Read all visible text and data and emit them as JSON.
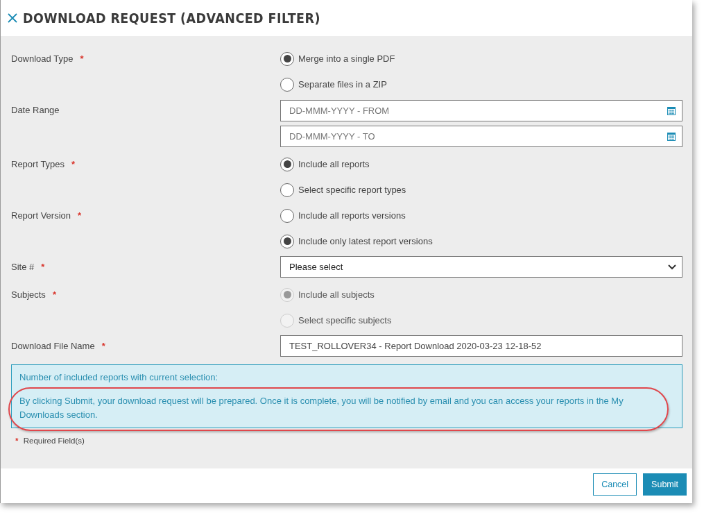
{
  "dialog": {
    "title": "DOWNLOAD REQUEST (ADVANCED FILTER)"
  },
  "required_mark": "*",
  "fields": [
    {
      "label": "Download Type",
      "required": true,
      "kind": "radio",
      "options": [
        {
          "label": "Merge into a single PDF",
          "selected": true,
          "disabled": false
        },
        {
          "label": "Separate files in a ZIP",
          "selected": false,
          "disabled": false
        }
      ]
    },
    {
      "label": "Date Range",
      "required": false,
      "kind": "date",
      "inputs": [
        {
          "placeholder": "DD-MMM-YYYY - FROM"
        },
        {
          "placeholder": "DD-MMM-YYYY - TO"
        }
      ]
    },
    {
      "label": "Report Types",
      "required": true,
      "kind": "radio",
      "options": [
        {
          "label": "Include all reports",
          "selected": true,
          "disabled": false
        },
        {
          "label": "Select specific report types",
          "selected": false,
          "disabled": false
        }
      ]
    },
    {
      "label": "Report Version",
      "required": true,
      "kind": "radio",
      "options": [
        {
          "label": "Include all reports versions",
          "selected": false,
          "disabled": false
        },
        {
          "label": "Include only latest report versions",
          "selected": true,
          "disabled": false
        }
      ]
    },
    {
      "label": "Site #",
      "required": true,
      "kind": "select",
      "value": "Please select"
    },
    {
      "label": "Subjects",
      "required": true,
      "kind": "radio",
      "options": [
        {
          "label": "Include all subjects",
          "selected": true,
          "disabled": true
        },
        {
          "label": "Select specific subjects",
          "selected": false,
          "disabled": true
        }
      ]
    },
    {
      "label": "Download File Name",
      "required": true,
      "kind": "text",
      "value": "TEST_ROLLOVER34 - Report Download 2020-03-23 12-18-52"
    }
  ],
  "info": {
    "lines": [
      {
        "text": "Number of included reports with current selection:",
        "highlighted": false
      },
      {
        "text": "By clicking Submit, your download request will be prepared. Once it is complete, you will be notified by email and you can access your reports in the My Downloads section.",
        "highlighted": true
      }
    ]
  },
  "required_note": "Required Field(s)",
  "buttons": [
    {
      "label": "Cancel",
      "kind": "secondary"
    },
    {
      "label": "Submit",
      "kind": "primary"
    }
  ]
}
